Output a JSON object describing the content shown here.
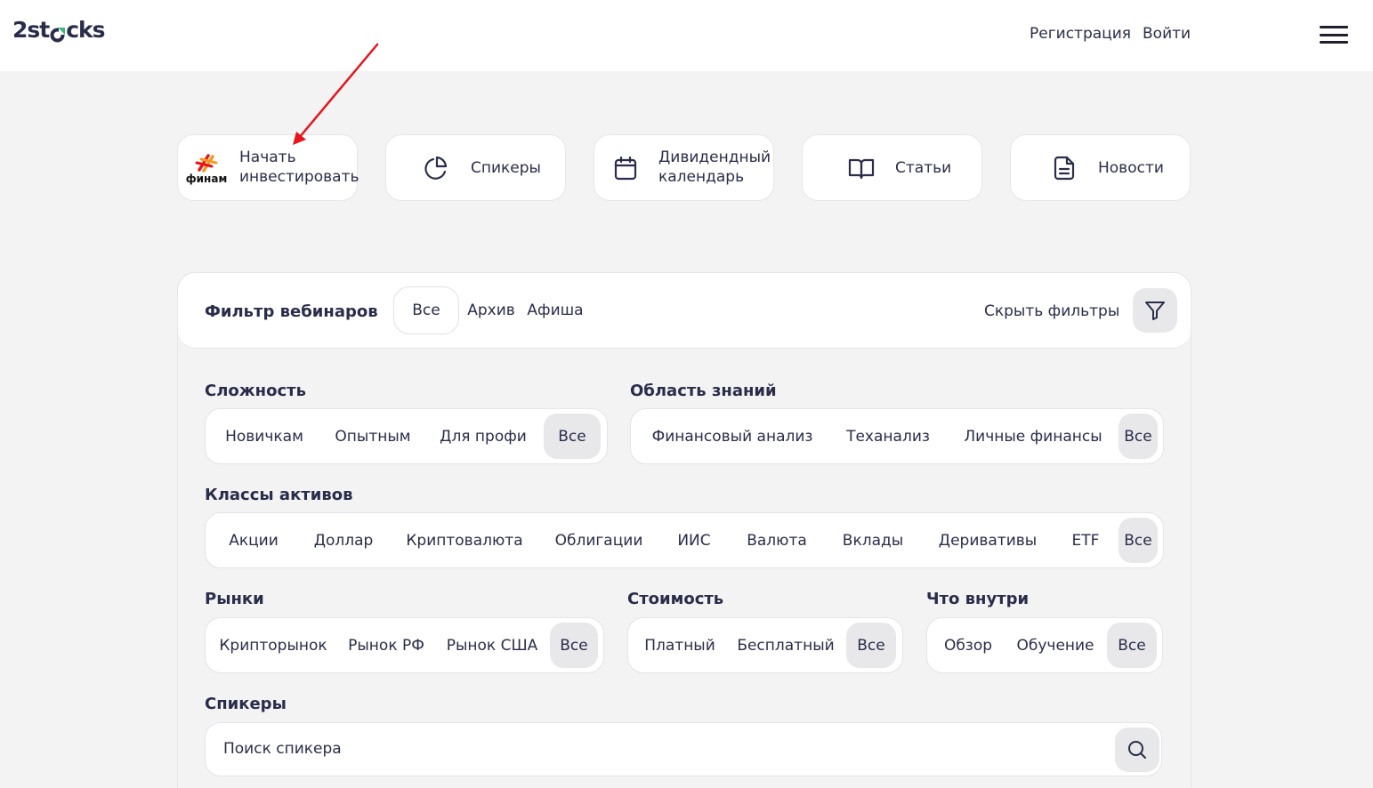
{
  "header": {
    "logo_left": "2st",
    "logo_right": "cks",
    "register": "Регистрация",
    "login": "Войти"
  },
  "nav_cards": {
    "finam_logo_text": "финам",
    "start_line1": "Начать",
    "start_line2": "инвестировать",
    "speakers": "Спикеры",
    "calendar_line1": "Дивидендный",
    "calendar_line2": "календарь",
    "articles": "Статьи",
    "news": "Новости"
  },
  "filter": {
    "title": "Фильтр вебинаров",
    "tabs": [
      "Все",
      "Архив",
      "Афиша"
    ],
    "hide_label": "Скрыть фильтры"
  },
  "complexity": {
    "title": "Сложность",
    "options": [
      "Новичкам",
      "Опытным",
      "Для профи",
      "Все"
    ]
  },
  "knowledge": {
    "title": "Область знаний",
    "options": [
      "Финансовый анализ",
      "Теханализ",
      "Личные финансы",
      "Все"
    ]
  },
  "assets": {
    "title": "Классы активов",
    "options": [
      "Акции",
      "Доллар",
      "Криптовалюта",
      "Облигации",
      "ИИС",
      "Валюта",
      "Вклады",
      "Деривативы",
      "ETF",
      "Все"
    ]
  },
  "markets": {
    "title": "Рынки",
    "options": [
      "Крипторынок",
      "Рынок РФ",
      "Рынок США",
      "Все"
    ]
  },
  "cost": {
    "title": "Стоимость",
    "options": [
      "Платный",
      "Бесплатный",
      "Все"
    ]
  },
  "inside": {
    "title": "Что внутри",
    "options": [
      "Обзор",
      "Обучение",
      "Все"
    ]
  },
  "speakers": {
    "title": "Спикеры",
    "search_placeholder": "Поиск спикера"
  },
  "colors": {
    "text": "#2a2d4a",
    "background": "#f3f3f3",
    "active_pill": "#e8e8ea",
    "logo_accent": "#3cb878",
    "annotation_arrow": "#e8141c"
  }
}
